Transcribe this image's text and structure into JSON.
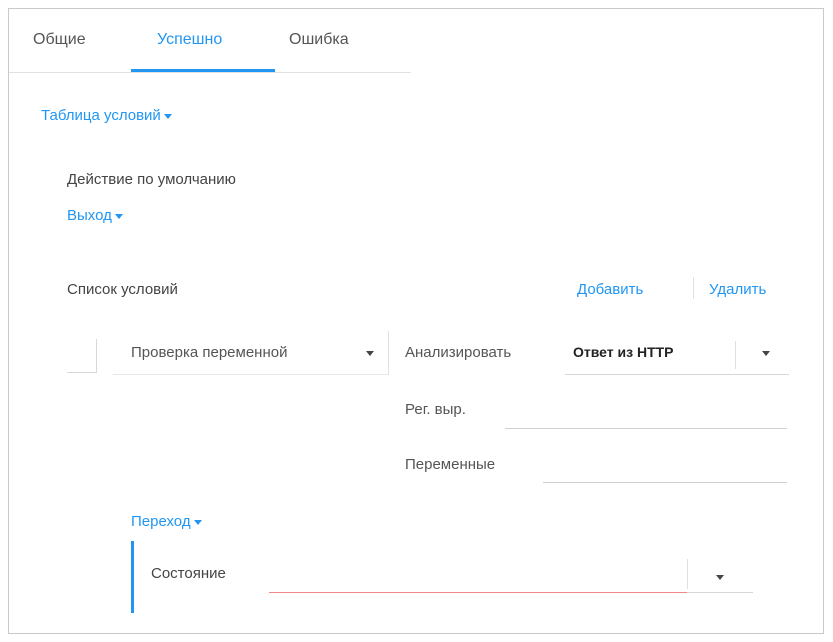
{
  "tabs": {
    "general": "Общие",
    "success": "Успешно",
    "error": "Ошибка"
  },
  "conditions_table": {
    "label": "Таблица условий"
  },
  "default_action": {
    "label": "Действие по умолчанию",
    "value": "Выход"
  },
  "condition_list": {
    "label": "Список условий",
    "add": "Добавить",
    "delete": "Удалить"
  },
  "condition": {
    "type": "Проверка переменной",
    "analyze_label": "Анализировать",
    "analyze_value": "Ответ из HTTP",
    "regex_label": "Рег. выр.",
    "regex_value": "",
    "variables_label": "Переменные",
    "variables_value": ""
  },
  "transition": {
    "label": "Переход",
    "state_label": "Состояние",
    "state_value": ""
  },
  "colors": {
    "accent": "#2196f3",
    "error_underline": "#f08a8a"
  }
}
